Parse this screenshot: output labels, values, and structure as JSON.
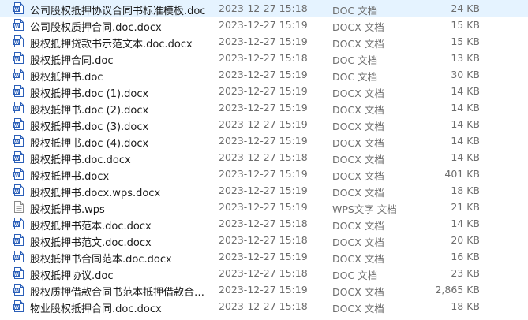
{
  "files": [
    {
      "name": "公司股权抵押协议合同书标准模板.doc",
      "date": "2023-12-27 15:18",
      "type": "DOC 文档",
      "size": "24 KB",
      "icon": "word-doc-icon"
    },
    {
      "name": "公司股权质押合同.doc.docx",
      "date": "2023-12-27 15:19",
      "type": "DOCX 文档",
      "size": "15 KB",
      "icon": "word-doc-icon"
    },
    {
      "name": "股权抵押贷款书示范文本.doc.docx",
      "date": "2023-12-27 15:19",
      "type": "DOCX 文档",
      "size": "15 KB",
      "icon": "word-doc-icon"
    },
    {
      "name": "股权抵押合同.doc",
      "date": "2023-12-27 15:18",
      "type": "DOC 文档",
      "size": "13 KB",
      "icon": "word-doc-icon"
    },
    {
      "name": "股权抵押书.doc",
      "date": "2023-12-27 15:19",
      "type": "DOC 文档",
      "size": "30 KB",
      "icon": "word-doc-icon"
    },
    {
      "name": "股权抵押书.doc (1).docx",
      "date": "2023-12-27 15:19",
      "type": "DOCX 文档",
      "size": "14 KB",
      "icon": "word-doc-icon"
    },
    {
      "name": "股权抵押书.doc (2).docx",
      "date": "2023-12-27 15:19",
      "type": "DOCX 文档",
      "size": "14 KB",
      "icon": "word-doc-icon"
    },
    {
      "name": "股权抵押书.doc (3).docx",
      "date": "2023-12-27 15:19",
      "type": "DOCX 文档",
      "size": "14 KB",
      "icon": "word-doc-icon"
    },
    {
      "name": "股权抵押书.doc (4).docx",
      "date": "2023-12-27 15:19",
      "type": "DOCX 文档",
      "size": "14 KB",
      "icon": "word-doc-icon"
    },
    {
      "name": "股权抵押书.doc.docx",
      "date": "2023-12-27 15:18",
      "type": "DOCX 文档",
      "size": "14 KB",
      "icon": "word-doc-icon"
    },
    {
      "name": "股权抵押书.docx",
      "date": "2023-12-27 15:19",
      "type": "DOCX 文档",
      "size": "401 KB",
      "icon": "word-doc-icon"
    },
    {
      "name": "股权抵押书.docx.wps.docx",
      "date": "2023-12-27 15:19",
      "type": "DOCX 文档",
      "size": "18 KB",
      "icon": "word-doc-icon"
    },
    {
      "name": "股权抵押书.wps",
      "date": "2023-12-27 15:19",
      "type": "WPS文字 文档",
      "size": "21 KB",
      "icon": "wps-doc-icon"
    },
    {
      "name": "股权抵押书范本.doc.docx",
      "date": "2023-12-27 15:18",
      "type": "DOCX 文档",
      "size": "14 KB",
      "icon": "word-doc-icon"
    },
    {
      "name": "股权抵押书范文.doc.docx",
      "date": "2023-12-27 15:18",
      "type": "DOCX 文档",
      "size": "20 KB",
      "icon": "word-doc-icon"
    },
    {
      "name": "股权抵押书合同范本.doc.docx",
      "date": "2023-12-27 15:19",
      "type": "DOCX 文档",
      "size": "16 KB",
      "icon": "word-doc-icon"
    },
    {
      "name": "股权抵押协议.doc",
      "date": "2023-12-27 15:18",
      "type": "DOC 文档",
      "size": "23 KB",
      "icon": "word-doc-icon"
    },
    {
      "name": "股权质押借款合同书范本抵押借款合同协...",
      "date": "2023-12-27 15:19",
      "type": "DOCX 文档",
      "size": "2,865 KB",
      "icon": "word-doc-icon"
    },
    {
      "name": "物业股权抵押合同.doc.docx",
      "date": "2023-12-27 15:18",
      "type": "DOCX 文档",
      "size": "18 KB",
      "icon": "word-doc-icon"
    }
  ],
  "colors": {
    "word_blue": "#2b5fb8",
    "text_gray": "#6d6d6d",
    "wps_gray": "#8a8a8a"
  }
}
